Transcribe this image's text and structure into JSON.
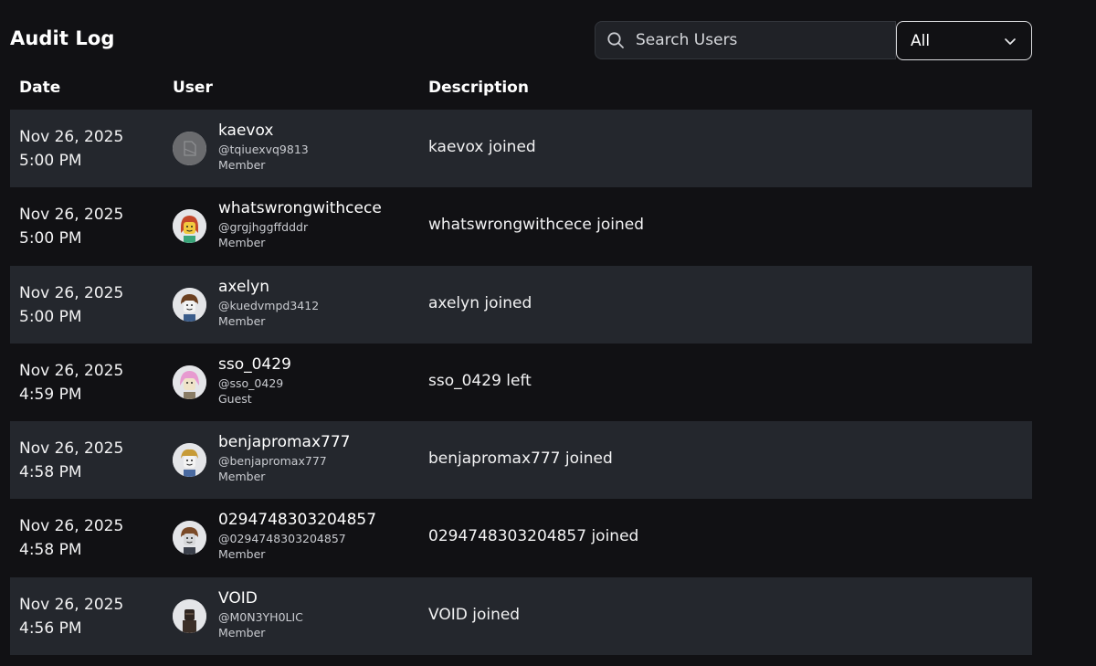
{
  "title": "Audit Log",
  "search": {
    "placeholder": "Search Users",
    "value": "",
    "icon": "search-icon"
  },
  "filter": {
    "selected": "All",
    "icon": "chevron-down-icon"
  },
  "columns": {
    "date": "Date",
    "user": "User",
    "description": "Description"
  },
  "colors": {
    "background": "#111114",
    "row_shaded": "#24272d",
    "text": "#ffffff",
    "muted": "#c9cbd0"
  },
  "rows": [
    {
      "date": "Nov 26, 2025",
      "time": "5:00 PM",
      "name": "kaevox",
      "handle": "@tqiuexvq9813",
      "role": "Member",
      "description": "kaevox joined",
      "avatar": "placeholder"
    },
    {
      "date": "Nov 26, 2025",
      "time": "5:00 PM",
      "name": "whatswrongwithcece",
      "handle": "@grgjhggffdddr",
      "role": "Member",
      "description": "whatswrongwithcece joined",
      "avatar": "red-hair"
    },
    {
      "date": "Nov 26, 2025",
      "time": "5:00 PM",
      "name": "axelyn",
      "handle": "@kuedvmpd3412",
      "role": "Member",
      "description": "axelyn joined",
      "avatar": "brown-hair"
    },
    {
      "date": "Nov 26, 2025",
      "time": "4:59 PM",
      "name": "sso_0429",
      "handle": "@sso_0429",
      "role": "Guest",
      "description": "sso_0429 left",
      "avatar": "pink-hair"
    },
    {
      "date": "Nov 26, 2025",
      "time": "4:58 PM",
      "name": "benjapromax777",
      "handle": "@benjapromax777",
      "role": "Member",
      "description": "benjapromax777 joined",
      "avatar": "blonde-hair"
    },
    {
      "date": "Nov 26, 2025",
      "time": "4:58 PM",
      "name": "0294748303204857",
      "handle": "@0294748303204857",
      "role": "Member",
      "description": "0294748303204857 joined",
      "avatar": "brown-hair-grey"
    },
    {
      "date": "Nov 26, 2025",
      "time": "4:56 PM",
      "name": "VOID",
      "handle": "@M0N3YH0LIC",
      "role": "Member",
      "description": "VOID joined",
      "avatar": "dark-figure"
    }
  ]
}
